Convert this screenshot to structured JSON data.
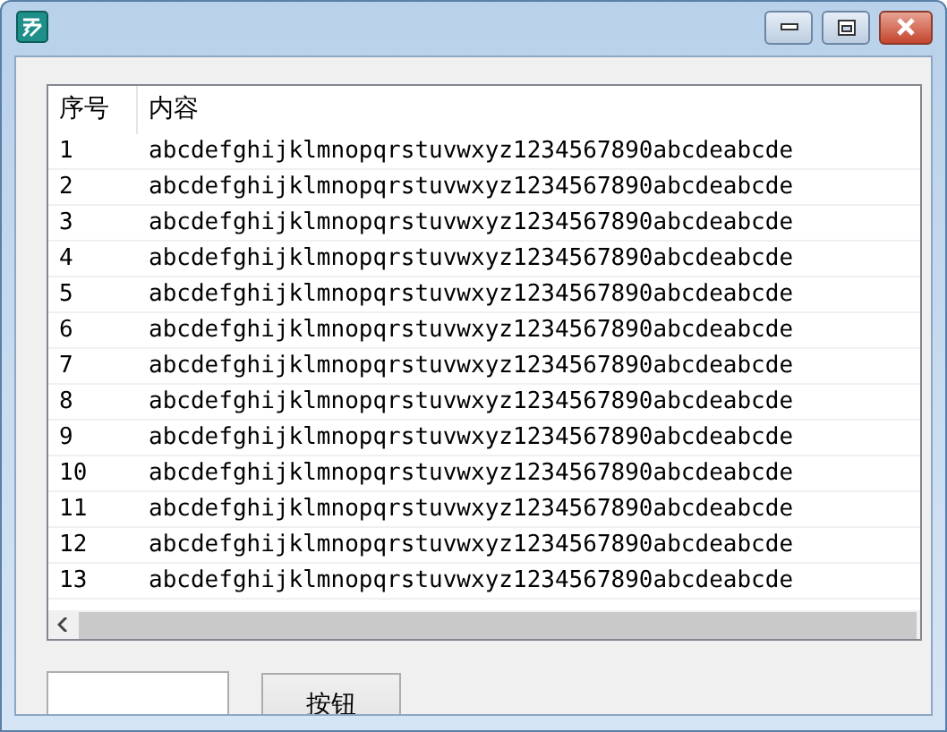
{
  "window": {
    "controls": [
      {
        "kind": "minimize"
      },
      {
        "kind": "maximize"
      },
      {
        "kind": "close"
      }
    ]
  },
  "list": {
    "columns": [
      "序号",
      "内容"
    ],
    "rows": [
      {
        "number": "1",
        "content": "abcdefghijklmnopqrstuvwxyz1234567890abcdeabcde"
      },
      {
        "number": "2",
        "content": "abcdefghijklmnopqrstuvwxyz1234567890abcdeabcde"
      },
      {
        "number": "3",
        "content": "abcdefghijklmnopqrstuvwxyz1234567890abcdeabcde"
      },
      {
        "number": "4",
        "content": "abcdefghijklmnopqrstuvwxyz1234567890abcdeabcde"
      },
      {
        "number": "5",
        "content": "abcdefghijklmnopqrstuvwxyz1234567890abcdeabcde"
      },
      {
        "number": "6",
        "content": "abcdefghijklmnopqrstuvwxyz1234567890abcdeabcde"
      },
      {
        "number": "7",
        "content": "abcdefghijklmnopqrstuvwxyz1234567890abcdeabcde"
      },
      {
        "number": "8",
        "content": "abcdefghijklmnopqrstuvwxyz1234567890abcdeabcde"
      },
      {
        "number": "9",
        "content": "abcdefghijklmnopqrstuvwxyz1234567890abcdeabcde"
      },
      {
        "number": "10",
        "content": "abcdefghijklmnopqrstuvwxyz1234567890abcdeabcde"
      },
      {
        "number": "11",
        "content": "abcdefghijklmnopqrstuvwxyz1234567890abcdeabcde"
      },
      {
        "number": "12",
        "content": "abcdefghijklmnopqrstuvwxyz1234567890abcdeabcde"
      },
      {
        "number": "13",
        "content": "abcdefghijklmnopqrstuvwxyz1234567890abcdeabcde"
      }
    ]
  },
  "button": {
    "label": "按钮"
  }
}
